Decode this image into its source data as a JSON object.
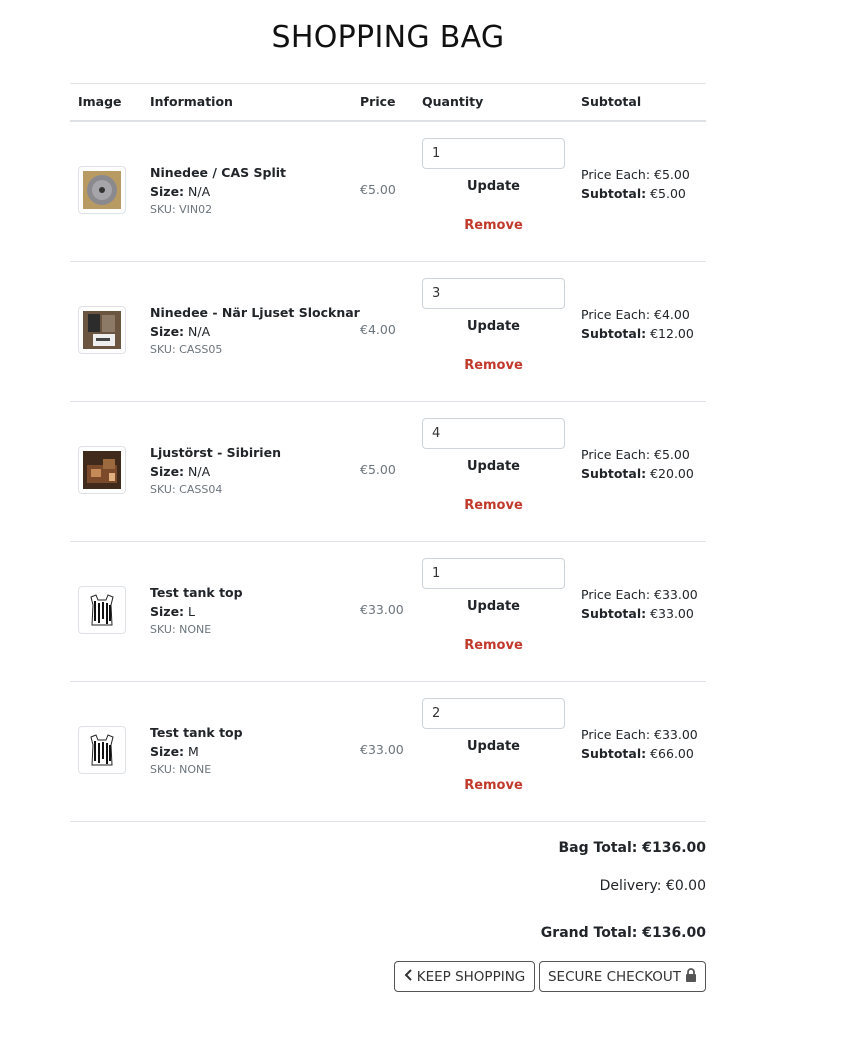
{
  "page": {
    "title": "SHOPPING BAG"
  },
  "table": {
    "headers": {
      "image": "Image",
      "information": "Information",
      "price": "Price",
      "quantity": "Quantity",
      "subtotal": "Subtotal"
    }
  },
  "labels": {
    "size": "Size:",
    "update": "Update",
    "remove": "Remove",
    "price_each": "Price Each:",
    "subtotal": "Subtotal:"
  },
  "items": [
    {
      "name": "Ninedee / CAS Split",
      "size": "N/A",
      "sku": "SKU: VIN02",
      "price": "€5.00",
      "quantity": "1",
      "price_each": "€5.00",
      "subtotal": "€5.00",
      "image_icon": "record-thumbnail-icon"
    },
    {
      "name": "Ninedee - När Ljuset Slocknar",
      "size": "N/A",
      "sku": "SKU: CASS05",
      "price": "€4.00",
      "quantity": "3",
      "price_each": "€4.00",
      "subtotal": "€12.00",
      "image_icon": "cassette-thumbnail-icon"
    },
    {
      "name": "Ljustörst - Sibirien",
      "size": "N/A",
      "sku": "SKU: CASS04",
      "price": "€5.00",
      "quantity": "4",
      "price_each": "€5.00",
      "subtotal": "€20.00",
      "image_icon": "cassette-thumbnail-icon"
    },
    {
      "name": "Test tank top",
      "size": "L",
      "sku": "SKU: NONE",
      "price": "€33.00",
      "quantity": "1",
      "price_each": "€33.00",
      "subtotal": "€33.00",
      "image_icon": "tank-top-thumbnail-icon"
    },
    {
      "name": "Test tank top",
      "size": "M",
      "sku": "SKU: NONE",
      "price": "€33.00",
      "quantity": "2",
      "price_each": "€33.00",
      "subtotal": "€66.00",
      "image_icon": "tank-top-thumbnail-icon"
    }
  ],
  "totals": {
    "bag_total": "Bag Total: €136.00",
    "delivery": "Delivery: €0.00",
    "grand_total": "Grand Total: €136.00"
  },
  "actions": {
    "keep_shopping": "KEEP SHOPPING",
    "secure_checkout": "SECURE CHECKOUT"
  },
  "colors": {
    "remove": "#c0392b",
    "border": "#dee2e6",
    "muted": "#6c757d"
  }
}
